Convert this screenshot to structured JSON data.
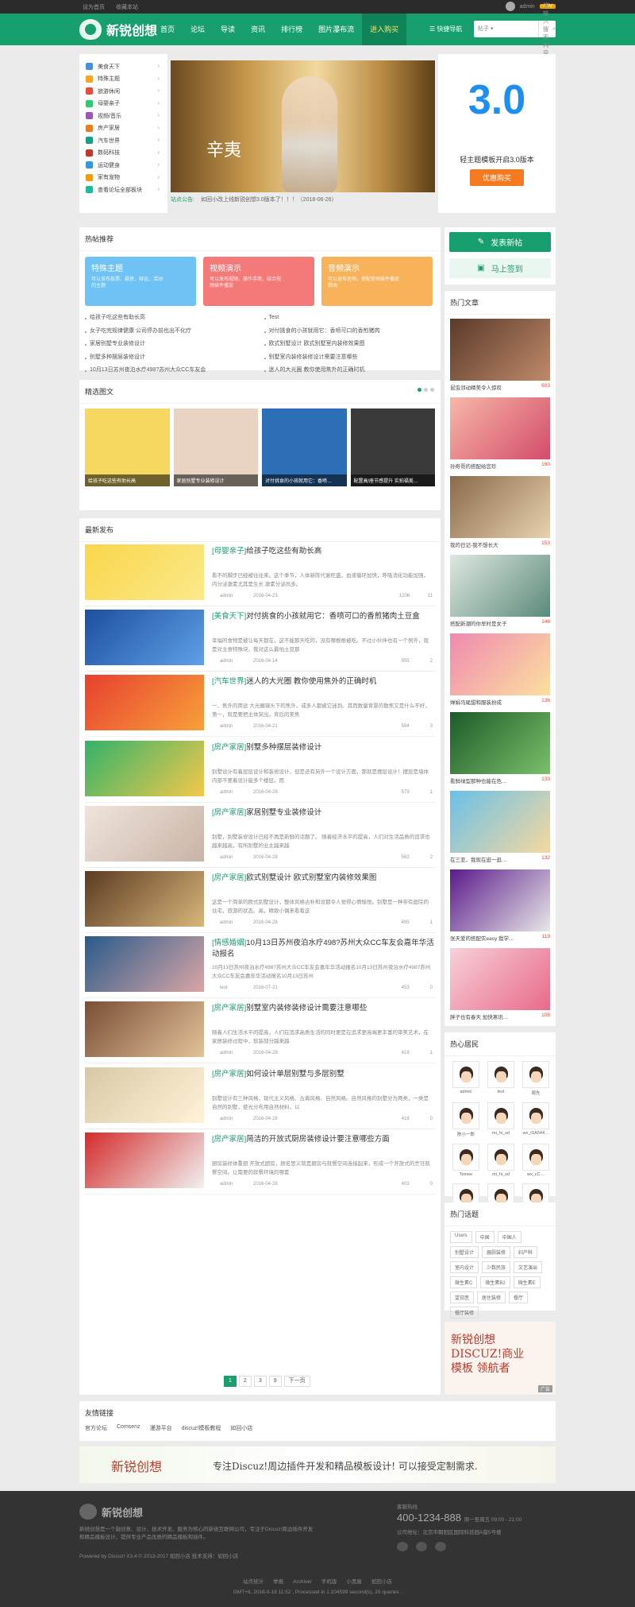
{
  "topbar": {
    "set_home": "设为首页",
    "favorite": "收藏本站",
    "username": "admin",
    "badge": "4.0V"
  },
  "header": {
    "logo_text": "新锐创想",
    "menu": [
      "首页",
      "论坛",
      "导读",
      "资讯",
      "排行榜",
      "图片瀑布流",
      "进入购买"
    ],
    "quick_nav": "快捷导航",
    "search_select": "帖子",
    "search_placeholder": "请输入搜索内容"
  },
  "categories": [
    {
      "label": "美食天下",
      "color": "#4a90d9"
    },
    {
      "label": "特殊主题",
      "color": "#f5a623"
    },
    {
      "label": "旅游休闲",
      "color": "#e74c3c"
    },
    {
      "label": "母婴亲子",
      "color": "#2ecc71"
    },
    {
      "label": "视频/音乐",
      "color": "#9b59b6"
    },
    {
      "label": "房产家居",
      "color": "#e67e22"
    },
    {
      "label": "汽车世界",
      "color": "#16a085"
    },
    {
      "label": "数码科技",
      "color": "#c0392b"
    },
    {
      "label": "运动健身",
      "color": "#3498db"
    },
    {
      "label": "家有宠物",
      "color": "#f39c12"
    },
    {
      "label": "查看论坛全部板块",
      "color": "#1abc9c"
    }
  ],
  "banner": {
    "overlay_text": "辛夷"
  },
  "notice": {
    "label": "站点公告:",
    "text": "如回小改上线新锐创想3.0版本了！！！（2018-06-26）"
  },
  "promo": {
    "number": "3.0",
    "title": "轻主题模板开启3.0版本",
    "button": "优惠购买"
  },
  "hot": {
    "title": "热帖推荐",
    "cards": [
      {
        "title": "特殊主题",
        "sub": "可以发布投票、悬赏、辩论、活动的主题",
        "color": "#6ec3f4"
      },
      {
        "title": "视频演示",
        "sub": "可以发布视频，操作手简，结合视频插件播放",
        "color": "#f47a7a"
      },
      {
        "title": "音频演示",
        "sub": "可以发布音频，搭配音频插件播放歌曲",
        "color": "#f7b25a"
      }
    ],
    "list": [
      "给孩子吃这些有助长高",
      "女子吃完规律健康 公司停办前也出不化疗",
      "家居别墅专业装修设计",
      "别墅多种摆层装修设计",
      "10月13日苏州夜泊水疗498?苏州大众CC车友会",
      "Test",
      "对付挑食的小孩就用它：香喷可口的香煎猪肉",
      "欧式别墅设计 欧式别墅室内装修效果图",
      "别墅室内装修装修设计需要注意哪些",
      "迷人的大光圈 教你使用焦外的正确时机"
    ]
  },
  "selected": {
    "title": "精选图文",
    "items": [
      {
        "caption": "给孩子吃这些有助长高",
        "bg": "#f6d860"
      },
      {
        "caption": "家居别墅专业装修设计",
        "bg": "#e9d4c4"
      },
      {
        "caption": "对付挑食的小孩就用它：香喷…",
        "bg": "#2d6fb7"
      },
      {
        "caption": "配置高/座节感提升 实拍福美…",
        "bg": "#3a3a3a"
      }
    ]
  },
  "latest": {
    "title": "最新发布",
    "posts": [
      {
        "cat": "[母婴亲子]",
        "title": "给孩子吃这些有助长高",
        "desc": "看不的脚步已经被往往来。这个季节，人体新陈代谢旺盛，血液循环加快，呼吸消化功能加强，内分泌激素尤其是生长 激素分泌尚多。",
        "author": "admin",
        "date": "2016-04-23",
        "views": "1206",
        "replies": "11",
        "bg": "linear-gradient(135deg,#f9d64b,#fbe98a)"
      },
      {
        "cat": "[美食天下]",
        "title": "对付挑食的小孩就用它：香喷可口的香煎猪肉土豆盒",
        "desc": "幸福的食物是被让每天都在，这不能那天吃的，没有哪根根被吃。不过小伙伴也有一个例外，就是对主食特殊块，我对这么最怕土豆那",
        "author": "admin",
        "date": "2016-04-14",
        "views": "955",
        "replies": "2",
        "bg": "linear-gradient(135deg,#1d4f9e,#5fa0e8)"
      },
      {
        "cat": "[汽车世界]",
        "title": "迷人的大光圈 教你使用焦外的正确时机",
        "desc": "一、焦外的用途 大光圈镜头下的焦外，或多人都被它迷到。其而数量背景的散焦又是什么不好，第一，就是要把主体突出，背后的美焦",
        "author": "admin",
        "date": "2016-04-21",
        "views": "594",
        "replies": "3",
        "bg": "linear-gradient(135deg,#e8402f,#f7a13a)"
      },
      {
        "cat": "[房产家居]",
        "title": "别墅多种摆层装修设计",
        "desc": "别墅设计有着层层设计和装修设计，但是还有另外一个设计方面，那就是摆层设计！摆层是墙体内部不要着设计能多个楼层，而",
        "author": "admin",
        "date": "2016-04-28",
        "views": "579",
        "replies": "1",
        "bg": "linear-gradient(135deg,#33b26a,#f5c84a)"
      },
      {
        "cat": "[房产家居]",
        "title": "家居别墅专业装修设计",
        "desc": "别墅，别墅装修设计已经不再是新鲜的话题了。 随着经济水平的提高，人们对生活品质的追求也越来越高，有所别墅的业主越来越",
        "author": "admin",
        "date": "2016-04-28",
        "views": "562",
        "replies": "2",
        "bg": "linear-gradient(135deg,#efe4dc,#c9b3a6)"
      },
      {
        "cat": "[房产家居]",
        "title": "欧式别墅设计 欧式别墅室内装修效果图",
        "desc": "这是一个简单的欧式别墅设计，整体风格古朴和设都令人觉得心情愉悦。别墅是一种带有庭院的住宅，旅游的状态。高，精致小偶来看看这",
        "author": "admin",
        "date": "2016-04-28",
        "views": "495",
        "replies": "1",
        "bg": "linear-gradient(135deg,#5a3b22,#d9b67a)"
      },
      {
        "cat": "[情感婚姻]",
        "title": "10月13日苏州夜泊水疗498?苏州大众CC车友会嘉年华活动报名",
        "desc": "10月13日苏州夜泊水疗498?苏州大众CC车友会嘉年华活动报名10月13日苏州夜泊水疗498?苏州大众CC车友会嘉年华活动报名10月13日苏州",
        "author": "test",
        "date": "2016-07-21",
        "views": "453",
        "replies": "0",
        "bg": "linear-gradient(135deg,#2a5a8a,#d9a6a6)"
      },
      {
        "cat": "[房产家居]",
        "title": "别墅室内装修装修设计需要注意哪些",
        "desc": "随着人们生活水平的提高，人们在追求高质生活的同时更是在追求更高端更丰富的审美艺术，在家居装修过程中，软装部分越来越",
        "author": "admin",
        "date": "2016-04-28",
        "views": "418",
        "replies": "1",
        "bg": "linear-gradient(135deg,#7a4e36,#e3c39a)"
      },
      {
        "cat": "[房产家居]",
        "title": "如何设计单层别墅与多层别墅",
        "desc": "别墅设计有三种风格，现代主义风格、古典风格、自然风格。自然风格的别墅分为两类，一类是自然的别墅，使光分布用自然材料，以",
        "author": "admin",
        "date": "2016-04-28",
        "views": "418",
        "replies": "0",
        "bg": "linear-gradient(135deg,#d8c8a6,#fff3d6)"
      },
      {
        "cat": "[房产家居]",
        "title": "简洁的开放式厨房装修设计要注意哪些方面",
        "desc": "厨房装修体重厨 开放式厨房，顾名思义就是厨房与就餐空间连接起来，形成一个开放式的烹饪就餐空间。让需要的就餐环境的哪套",
        "author": "admin",
        "date": "2016-04-28",
        "views": "403",
        "replies": "0",
        "bg": "linear-gradient(135deg,#d42b2b,#f1f1f1)"
      }
    ],
    "pager": [
      "1",
      "2",
      "3",
      "9",
      "下一页"
    ]
  },
  "sidebar": {
    "post_button": "发表新帖",
    "sign_button": "马上签到",
    "articles_title": "热门文章",
    "articles": [
      {
        "title": "昆虫邻动精美令人惊叹",
        "views": "603",
        "bg": "linear-gradient(135deg,#5a3a2a,#c08a6a)"
      },
      {
        "title": "孙奇哥的搭配给您珍",
        "views": "190",
        "bg": "linear-gradient(135deg,#f6b8a8,#d44b6a)"
      },
      {
        "title": "我的日记-我不想长大",
        "views": "153",
        "bg": "linear-gradient(135deg,#8a6a4a,#e8d2b0)"
      },
      {
        "title": "搭配新潮的你早时是女子",
        "views": "148",
        "bg": "linear-gradient(135deg,#dfe8e0,#5a8a7a)"
      },
      {
        "title": "婵娟马尾甜和服装扮成",
        "views": "136",
        "bg": "linear-gradient(135deg,#f08ab0,#fbe0a0)"
      },
      {
        "title": "看鲜绿型那种也能在色…",
        "views": "133",
        "bg": "linear-gradient(135deg,#1d5a2a,#7ac06a)"
      },
      {
        "title": "在三亚，我现在逛一逛…",
        "views": "132",
        "bg": "linear-gradient(135deg,#6ac0e8,#f6d8a0)"
      },
      {
        "title": "张天爱的搭配实easy 我学…",
        "views": "119",
        "bg": "linear-gradient(135deg,#5a1a8a,#e8e8e8)"
      },
      {
        "title": "胖子也有春天 加快寒讯…",
        "views": "108",
        "bg": "linear-gradient(135deg,#f8d0d8,#e86a8a)"
      }
    ],
    "fans_title": "热心居民",
    "fans": [
      "admin",
      "test",
      "周先",
      "陈小一郎",
      "mi_hi_sd",
      "wx_iSA544…",
      "Tomee",
      "mi_hi_sd",
      "wx_cC…",
      "tummy",
      "冰能仔Die",
      "wx_iz1231…"
    ],
    "tags_title": "热门话题",
    "tags": [
      "Users",
      "中国",
      "中国人",
      "别墅设计",
      "器厨装修",
      "妇产科",
      "室内设计",
      "少数民族",
      "文艺演出",
      "微生素C",
      "微生素B2",
      "微生素E",
      "望日医",
      "居住装修",
      "餐厅",
      "餐厅装修"
    ],
    "ad_text": "新锐创想 DISCUZ!商业模板 领航者",
    "ad_badge": "广告"
  },
  "links": {
    "title": "友情链接",
    "items": [
      "官方论坛",
      "Comsenz",
      "漫游平台",
      "discuz!模板教程",
      "如回小店"
    ]
  },
  "banner2": {
    "text1": "新锐创想",
    "text2": "专注Discuz!周边插件开发和精品模板设计! 可以接受定制需求."
  },
  "footer": {
    "logo": "新锐创想",
    "desc": "新锐创想是一个融创意、设计、技术开发、服务为核心的新锐互联网公司，专注于Discuz!周边插件开发和精品模板设计，提供专业产品优质的精品模板和插件。",
    "powered": "Powered by Discuz! X3.4    © 2013-2017 如回小店    技术支持：如回小店",
    "contact_label": "客服热线",
    "phone": "400-1234-888",
    "hours": "周一至周五 09:00 - 21:00",
    "address": "公司地址：北京市朝阳区国际科技园A座5号楼",
    "bottom_links": [
      "站点统计",
      "举报",
      "Archiver",
      "手机版",
      "小黑屋",
      "如回小店"
    ],
    "copyright": "GMT+8, 2018-9-18 11:52 , Processed in 1.104599 second(s), 20 queries ."
  }
}
